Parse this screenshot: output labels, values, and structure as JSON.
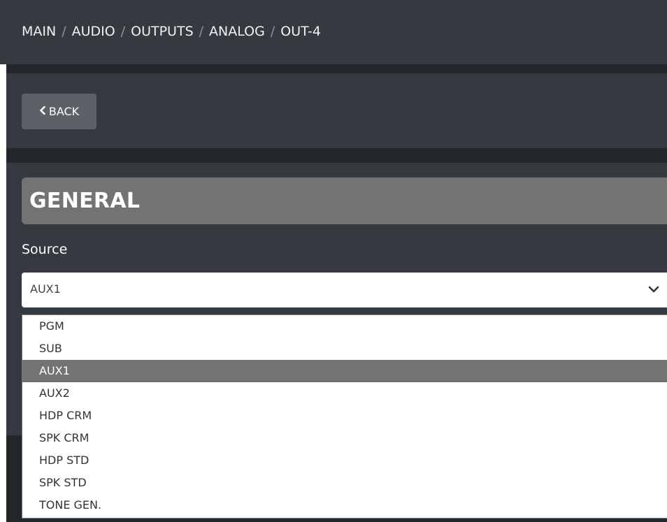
{
  "breadcrumb": {
    "items": [
      "MAIN",
      "AUDIO",
      "OUTPUTS",
      "ANALOG",
      "OUT-4"
    ],
    "separator": "/"
  },
  "toolbar": {
    "back_label": "BACK",
    "back_icon": "chevron-left-icon"
  },
  "general": {
    "title": "GENERAL",
    "source_label": "Source",
    "source_value": "AUX1",
    "dropdown_icon": "chevron-down-icon",
    "options": [
      "PGM",
      "SUB",
      "AUX1",
      "AUX2",
      "HDP CRM",
      "SPK CRM",
      "HDP STD",
      "SPK STD",
      "TONE GEN."
    ],
    "selected_option": "AUX1"
  },
  "colors": {
    "header_bg": "#343a40",
    "band_dark": "#23272b",
    "button_bg": "#5b6167",
    "section_header_bg": "#737373",
    "selected_option_bg": "#737373"
  }
}
